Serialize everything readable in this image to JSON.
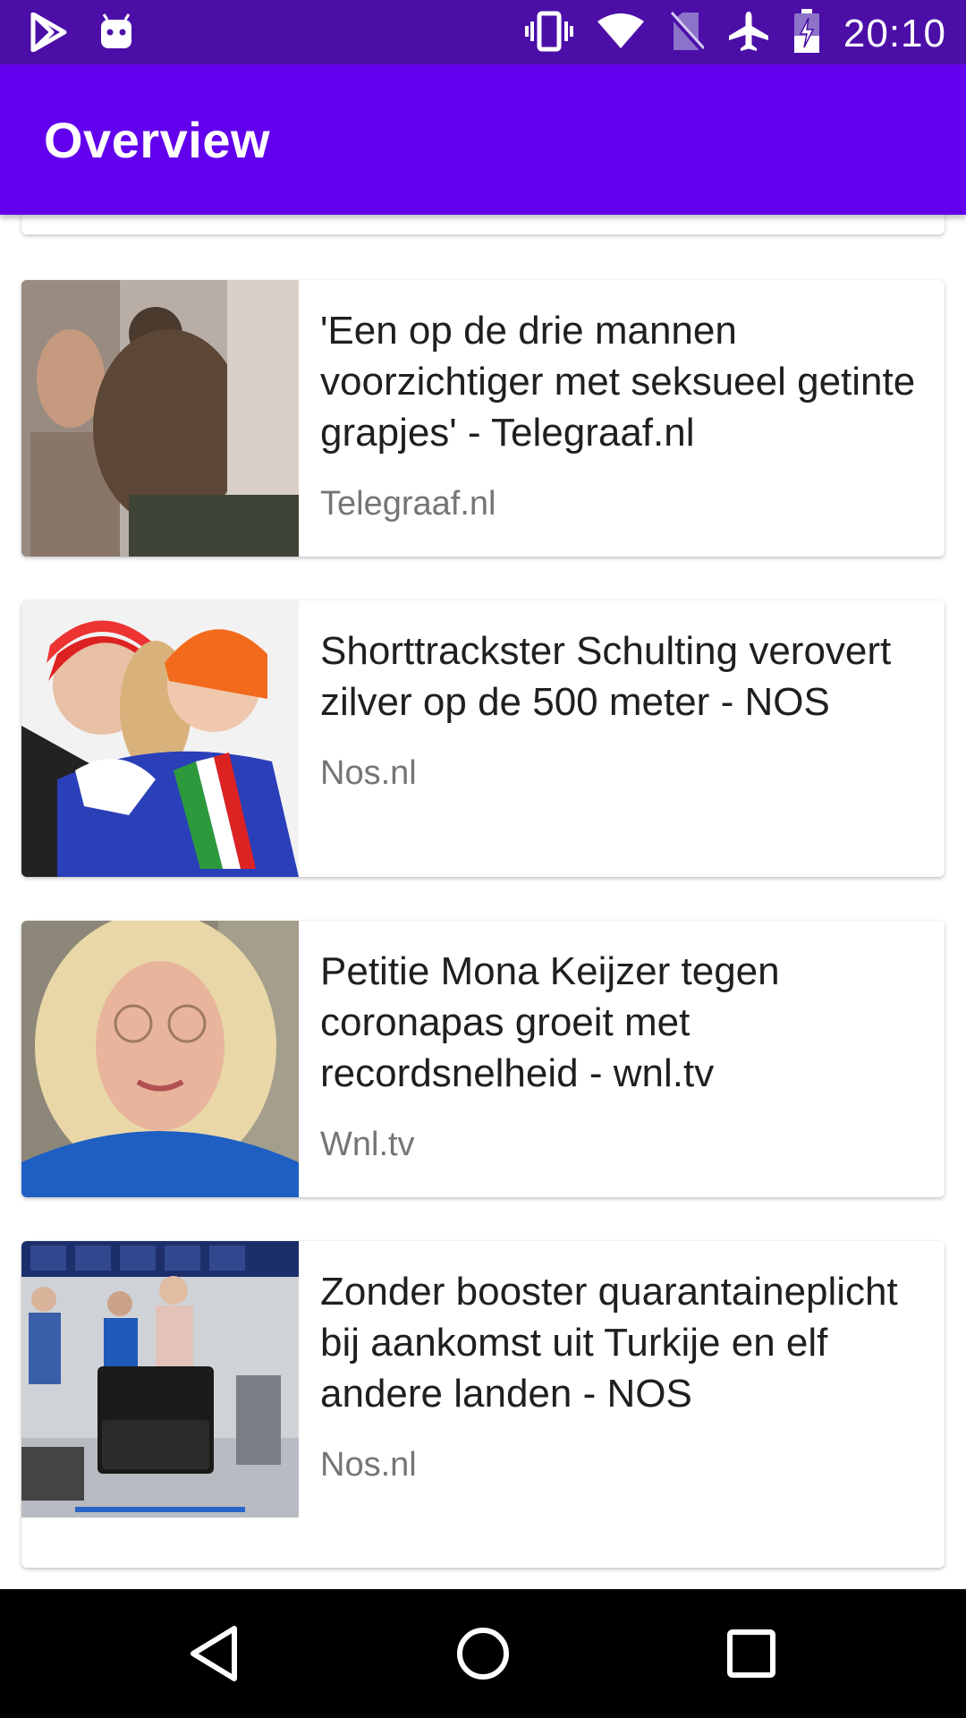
{
  "status_bar": {
    "time": "20:10",
    "left_icons": [
      "play-store-icon",
      "android-debug-icon"
    ],
    "right_icons": [
      "vibrate-icon",
      "wifi-icon",
      "no-sim-icon",
      "airplane-mode-icon",
      "battery-charging-icon"
    ]
  },
  "app_bar": {
    "title": "Overview"
  },
  "articles": [
    {
      "headline": "'Een op de drie mannen voorzichtiger met seksueel getinte grapjes' - Telegraaf.nl",
      "source": "Telegraaf.nl"
    },
    {
      "headline": "Shorttrackster Schulting verovert zilver op de 500 meter - NOS",
      "source": "Nos.nl"
    },
    {
      "headline": "Petitie Mona Keijzer tegen coronapas groeit met recordsnelheid - wnl.tv",
      "source": "Wnl.tv"
    },
    {
      "headline": "Zonder booster quarantaineplicht bij aankomst uit Turkije en elf andere landen - NOS",
      "source": "Nos.nl"
    }
  ],
  "nav_bar": {
    "icons": [
      "back-icon",
      "home-icon",
      "recents-icon"
    ]
  },
  "colors": {
    "status_bar": "#4b0fa8",
    "app_bar": "#6200ee",
    "nav_bar": "#000000"
  }
}
